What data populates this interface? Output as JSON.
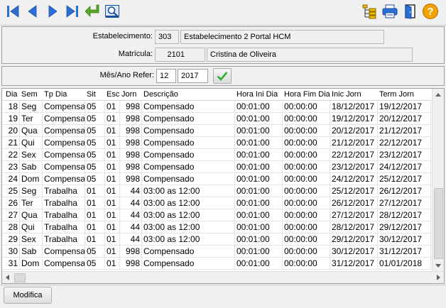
{
  "toolbar": {
    "left_icons": [
      "first-record-icon",
      "previous-record-icon",
      "next-record-icon",
      "last-record-icon",
      "return-icon",
      "search-icon"
    ],
    "right_icons": [
      "tree-icon",
      "print-icon",
      "exit-door-icon",
      "help-icon"
    ],
    "help_glyph": "?"
  },
  "header": {
    "estab_label": "Estabelecimento:",
    "estab_code": "303",
    "estab_name": "Estabelecimento 2 Portal HCM",
    "matricula_label": "Matrícula:",
    "matricula_code": "2101",
    "matricula_name": "Cristina de Oliveira"
  },
  "period": {
    "label": "Mês/Ano Refer:",
    "month": "12",
    "year": "2017"
  },
  "grid": {
    "columns": [
      "Dia",
      "Sem",
      "Tp Dia",
      "Sit",
      "Esc",
      "Jorn",
      "Descrição",
      "Hora Ini Dia",
      "Hora Fim Dia",
      "Inic  Jorn",
      "Term  Jorn"
    ],
    "rows": [
      [
        "18",
        "Seg",
        "Compensa",
        "05",
        "01",
        "998",
        "Compensado",
        "00:01:00",
        "00:00:00",
        "18/12/2017",
        "19/12/2017"
      ],
      [
        "19",
        "Ter",
        "Compensa",
        "05",
        "01",
        "998",
        "Compensado",
        "00:01:00",
        "00:00:00",
        "19/12/2017",
        "20/12/2017"
      ],
      [
        "20",
        "Qua",
        "Compensa",
        "05",
        "01",
        "998",
        "Compensado",
        "00:01:00",
        "00:00:00",
        "20/12/2017",
        "21/12/2017"
      ],
      [
        "21",
        "Qui",
        "Compensa",
        "05",
        "01",
        "998",
        "Compensado",
        "00:01:00",
        "00:00:00",
        "21/12/2017",
        "22/12/2017"
      ],
      [
        "22",
        "Sex",
        "Compensa",
        "05",
        "01",
        "998",
        "Compensado",
        "00:01:00",
        "00:00:00",
        "22/12/2017",
        "23/12/2017"
      ],
      [
        "23",
        "Sab",
        "Compensa",
        "05",
        "01",
        "998",
        "Compensado",
        "00:01:00",
        "00:00:00",
        "23/12/2017",
        "24/12/2017"
      ],
      [
        "24",
        "Dom",
        "Compensa",
        "05",
        "01",
        "998",
        "Compensado",
        "00:01:00",
        "00:00:00",
        "24/12/2017",
        "25/12/2017"
      ],
      [
        "25",
        "Seg",
        "Trabalha",
        "01",
        "01",
        "44",
        "03:00 as 12:00",
        "00:01:00",
        "00:00:00",
        "25/12/2017",
        "26/12/2017"
      ],
      [
        "26",
        "Ter",
        "Trabalha",
        "01",
        "01",
        "44",
        "03:00 as 12:00",
        "00:01:00",
        "00:00:00",
        "26/12/2017",
        "27/12/2017"
      ],
      [
        "27",
        "Qua",
        "Trabalha",
        "01",
        "01",
        "44",
        "03:00 as 12:00",
        "00:01:00",
        "00:00:00",
        "27/12/2017",
        "28/12/2017"
      ],
      [
        "28",
        "Qui",
        "Trabalha",
        "01",
        "01",
        "44",
        "03:00 as 12:00",
        "00:01:00",
        "00:00:00",
        "28/12/2017",
        "29/12/2017"
      ],
      [
        "29",
        "Sex",
        "Trabalha",
        "01",
        "01",
        "44",
        "03:00 as 12:00",
        "00:01:00",
        "00:00:00",
        "29/12/2017",
        "30/12/2017"
      ],
      [
        "30",
        "Sab",
        "Compensa",
        "05",
        "01",
        "998",
        "Compensado",
        "00:01:00",
        "00:00:00",
        "30/12/2017",
        "31/12/2017"
      ],
      [
        "31",
        "Dom",
        "Compensa",
        "05",
        "01",
        "998",
        "Compensado",
        "00:01:00",
        "00:00:00",
        "31/12/2017",
        "01/01/2018"
      ]
    ]
  },
  "footer": {
    "modify_label": "Modifica"
  },
  "colors": {
    "nav_blue": "#2a6fd6",
    "return_green": "#5aa82a",
    "check_green": "#2fae2f",
    "help_orange": "#f2a100"
  }
}
